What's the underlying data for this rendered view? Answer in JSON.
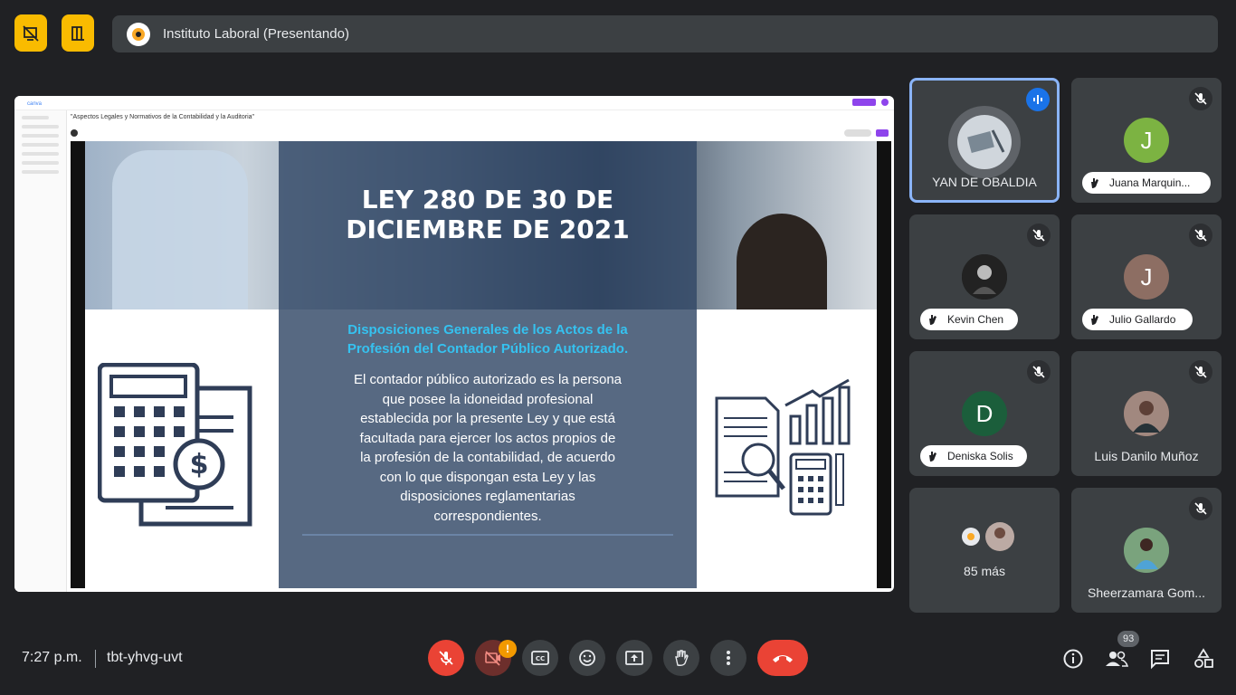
{
  "header": {
    "presenter": "Instituto Laboral (Presentando)"
  },
  "presentation": {
    "doc_title": "\"Aspectos Legales y Normativos de la Contabilidad y la Auditoria\"",
    "heading_line1": "LEY 280 DE 30 DE",
    "heading_line2": "DICIEMBRE DE 2021",
    "subheading_line1": "Disposiciones Generales de los Actos de la",
    "subheading_line2": "Profesión del Contador Público Autorizado.",
    "body_lines": [
      "El contador público autorizado es la persona",
      "que posee la idoneidad profesional",
      "establecida por la presente Ley y que está",
      "facultada para ejercer los actos propios de",
      "la profesión de la contabilidad, de acuerdo",
      "con lo que dispongan esta Ley y las",
      "disposiciones reglamentarias",
      "correspondientes."
    ]
  },
  "participants": [
    {
      "name": "YAN DE OBALDIA",
      "speaking": true
    },
    {
      "name": "Juana Marquin...",
      "initial": "J",
      "avatar_color": "#7cb342",
      "muted": true
    },
    {
      "name": "Kevin Chen",
      "muted": true
    },
    {
      "name": "Julio Gallardo",
      "initial": "J",
      "avatar_color": "#8d6e63",
      "muted": true
    },
    {
      "name": "Deniska Solis",
      "initial": "D",
      "avatar_color": "#1b5e3b",
      "muted": true
    },
    {
      "name": "Luis Danilo Muñoz",
      "muted": true
    },
    {
      "name": "85 más"
    },
    {
      "name": "Sheerzamara Gom...",
      "muted": true
    }
  ],
  "footer": {
    "time": "7:27 p.m.",
    "meeting_code": "tbt-yhvg-uvt",
    "camera_alert": "!",
    "people_count": "93"
  },
  "colors": {
    "accent_yellow": "#f9bb00",
    "danger_red": "#ea4335",
    "active_border": "#8ab4f8",
    "slide_accent": "#35c2f0"
  }
}
